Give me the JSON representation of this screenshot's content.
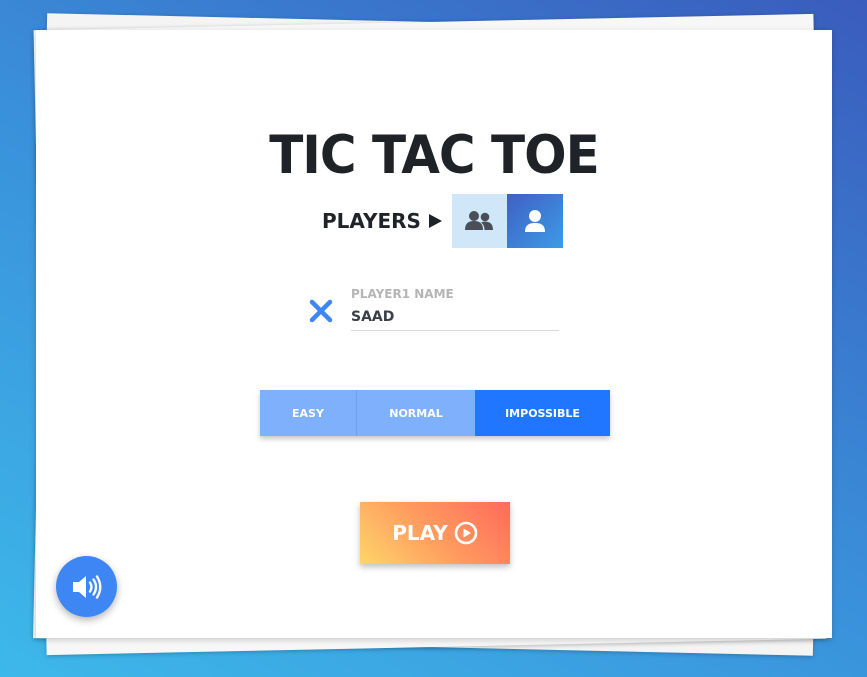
{
  "app": {
    "title": "TIC TAC TOE"
  },
  "players": {
    "label": "PLAYERS",
    "modes": [
      {
        "icon": "users-icon",
        "selected": false
      },
      {
        "icon": "user-icon",
        "selected": true
      }
    ]
  },
  "player1": {
    "label": "PLAYER1 NAME",
    "value": "SAAD",
    "marker_icon": "x-icon",
    "marker_color": "#3d86f4"
  },
  "difficulty": {
    "options": [
      "EASY",
      "NORMAL",
      "IMPOSSIBLE"
    ],
    "selected": "IMPOSSIBLE"
  },
  "play_button": {
    "label": "PLAY",
    "icon": "play-circle-icon"
  },
  "sound_button": {
    "icon": "volume-icon"
  },
  "colors": {
    "accent": "#2176ff",
    "accent_light": "#7fb0fb",
    "title": "#1f2328",
    "sound": "#3d86f4"
  }
}
